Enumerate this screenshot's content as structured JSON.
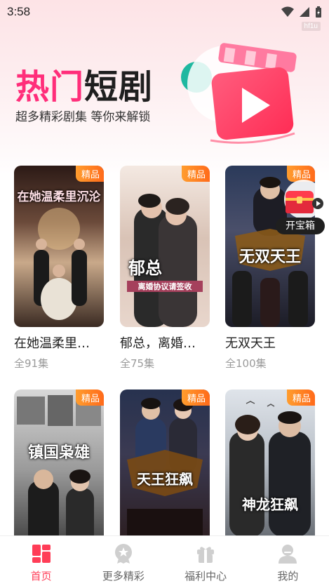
{
  "status": {
    "time": "3:58",
    "tag": "hf1u"
  },
  "hero": {
    "title_pink": "热门",
    "title_dark": "短剧",
    "subtitle": "超多精彩剧集 等你来解锁"
  },
  "badge_label": "精品",
  "floating": {
    "label": "开宝箱"
  },
  "cards": [
    {
      "name": "在她温柔里…",
      "count": "全91集",
      "poster_text": "在她温柔里沉沦"
    },
    {
      "name": "郁总，离婚…",
      "count": "全75集",
      "poster_text": "郁总",
      "poster_sub": "离婚协议请签收"
    },
    {
      "name": "无双天王",
      "count": "全100集",
      "poster_text": "无双天王"
    },
    {
      "name": "",
      "count": "",
      "poster_text": "镇国枭雄"
    },
    {
      "name": "",
      "count": "",
      "poster_text": "天王狂飙"
    },
    {
      "name": "",
      "count": "",
      "poster_text": "神龙狂飙"
    }
  ],
  "tabs": [
    {
      "label": "首页",
      "icon": "home-grid-icon",
      "active": true
    },
    {
      "label": "更多精彩",
      "icon": "star-badge-icon",
      "active": false
    },
    {
      "label": "福利中心",
      "icon": "gift-icon",
      "active": false
    },
    {
      "label": "我的",
      "icon": "user-icon",
      "active": false
    }
  ],
  "colors": {
    "accent": "#ff3d57",
    "pink": "#ff2e7a",
    "badge": "#ff7a1a"
  }
}
